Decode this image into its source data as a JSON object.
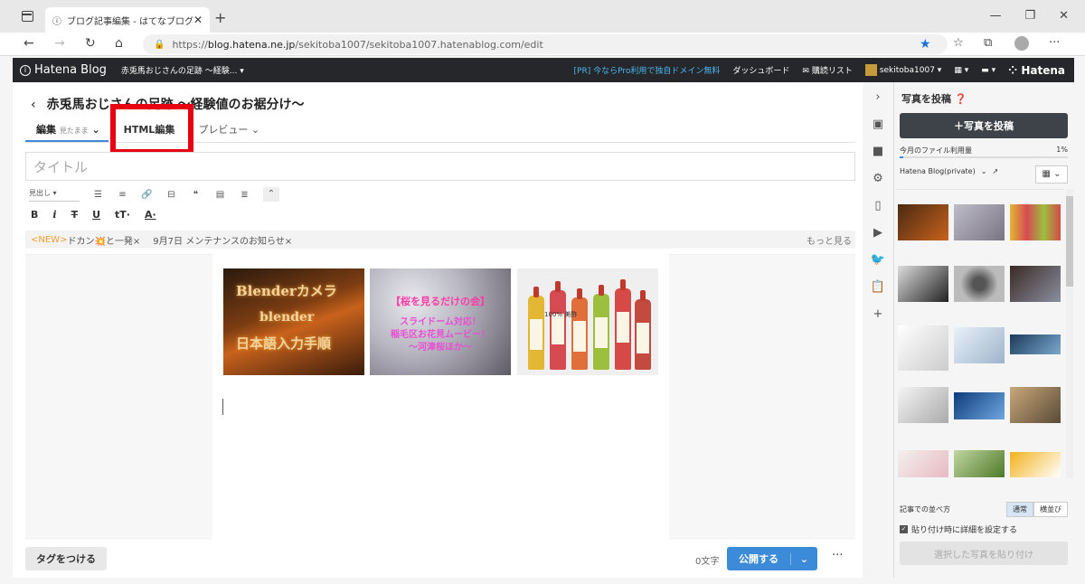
{
  "browser": {
    "tab_title": "ブログ記事編集 - はてなブログ",
    "url_prefix": "https://",
    "url_host": "blog.hatena.ne.jp",
    "url_path": "/sekitoba1007/sekitoba1007.hatenablog.com/edit"
  },
  "hatena_header": {
    "logo": "Hatena Blog",
    "blog_name": "赤兎馬おじさんの足跡 ～経験...",
    "pr_text": "[PR] 今ならPro利用で独自ドメイン無料",
    "dashboard": "ダッシュボード",
    "reading_list": "購読リスト",
    "user": "sekitoba1007",
    "brand": "Hatena"
  },
  "editor": {
    "blog_title": "赤兎馬おじさんの足跡 ～経験値のお裾分け～",
    "tabs": {
      "edit": "編集",
      "edit_sub": "見たまま",
      "html": "HTML編集",
      "preview": "プレビュー"
    },
    "title_placeholder": "タイトル",
    "heading_select": "見出し",
    "format": {
      "bold": "B",
      "italic": "i",
      "strike": "T",
      "underline": "U",
      "size": "tT",
      "color": "A"
    },
    "news": {
      "new_badge": "<NEW>",
      "item1": "ドカン💥と一発×",
      "item2": "9月7日 メンテナンスのお知らせ×",
      "more": "もっと見る"
    },
    "images": {
      "img1_line1": "Blenderカメラ",
      "img1_line2": "blender",
      "img1_line3": "日本語入力手順",
      "img2_line1": "【桜を見るだけの会】",
      "img2_line2": "スライドーム対応！",
      "img2_line3": "稲毛区お花見ムービー！",
      "img2_line4": "～河津桜ほか～",
      "img3_label": "100% 美酢"
    },
    "tag_button": "タグをつける",
    "char_count": "0文字",
    "publish": "公開する"
  },
  "photo_panel": {
    "title": "写真を投稿",
    "upload_button": "写真を投稿",
    "usage_label": "今月のファイル利用量",
    "usage_percent": "1%",
    "usage_fraction": 0.01,
    "album": "Hatena Blog(private)",
    "order_label": "記事での並べ方",
    "order_normal": "通常",
    "order_side": "横並び",
    "checkbox_label": "貼り付け時に詳細を設定する",
    "paste_button": "選択した写真を貼り付け"
  },
  "colors": {
    "accent": "#3b8bd8",
    "highlight": "#e60012",
    "header_bg": "#25272a",
    "new_badge": "#f39b2c"
  }
}
